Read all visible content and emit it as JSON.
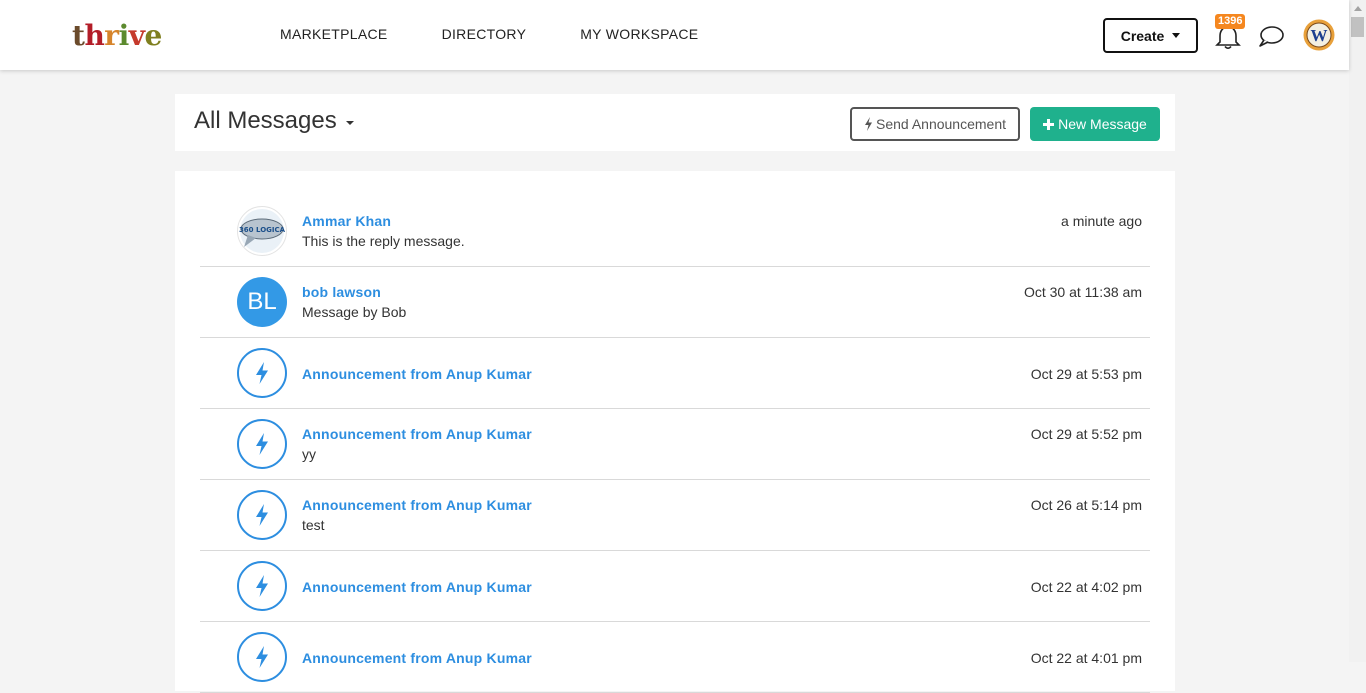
{
  "brand": {
    "logo_text": "thrive",
    "logo_colors": [
      "#6b4b2b",
      "#b31d28",
      "#d6842b",
      "#5c8a2e",
      "#c53a2c",
      "#7f7f1f"
    ]
  },
  "nav": {
    "items": [
      "MARKETPLACE",
      "DIRECTORY",
      "MY WORKSPACE"
    ]
  },
  "header_right": {
    "create_label": "Create",
    "notification_count": "1396",
    "bell_icon": "bell-icon",
    "chat_icon": "chat-bubble-icon",
    "avatar_letter": "W"
  },
  "page": {
    "title": "All Messages",
    "send_announcement_label": "Send Announcement",
    "new_message_label": "New Message"
  },
  "colors": {
    "accent_blue": "#2d8ee0",
    "green_button": "#1fb18d",
    "badge_orange": "#f5871f",
    "avatar_blue": "#3399e6"
  },
  "messages": [
    {
      "sender": "Ammar Khan",
      "preview": "This is the reply message.",
      "time": "a minute ago",
      "avatar": "logo",
      "avatar_text": "360 LOGICA"
    },
    {
      "sender": "bob lawson",
      "preview": "Message by Bob",
      "time": "Oct 30 at 11:38 am",
      "avatar": "initials",
      "avatar_text": "BL"
    },
    {
      "sender": "Announcement from Anup Kumar",
      "preview": "",
      "time": "Oct 29 at 5:53 pm",
      "avatar": "bolt"
    },
    {
      "sender": "Announcement from Anup Kumar",
      "preview": "yy",
      "time": "Oct 29 at 5:52 pm",
      "avatar": "bolt"
    },
    {
      "sender": "Announcement from Anup Kumar",
      "preview": "test",
      "time": "Oct 26 at 5:14 pm",
      "avatar": "bolt"
    },
    {
      "sender": "Announcement from Anup Kumar",
      "preview": "",
      "time": "Oct 22 at 4:02 pm",
      "avatar": "bolt"
    },
    {
      "sender": "Announcement from Anup Kumar",
      "preview": "",
      "time": "Oct 22 at 4:01 pm",
      "avatar": "bolt"
    }
  ]
}
